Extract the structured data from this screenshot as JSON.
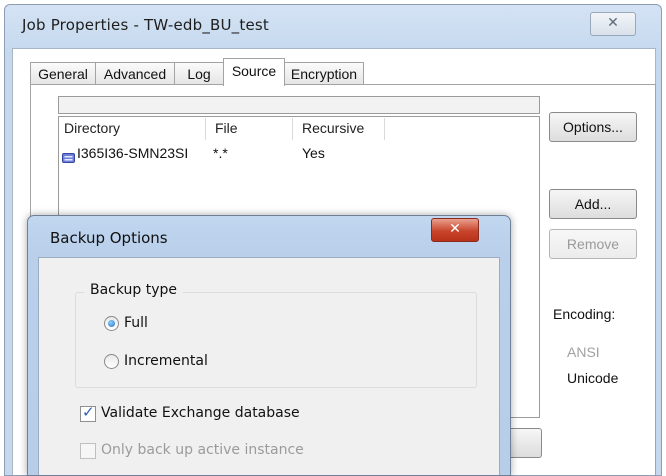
{
  "window": {
    "title": "Job Properties - TW-edb_BU_test",
    "close_glyph": "✕"
  },
  "tabs": [
    {
      "label": "General",
      "selected": false
    },
    {
      "label": "Advanced",
      "selected": false
    },
    {
      "label": "Log",
      "selected": false
    },
    {
      "label": "Source",
      "selected": true
    },
    {
      "label": "Encryption",
      "selected": false
    }
  ],
  "source_list": {
    "columns": [
      "Directory",
      "File",
      "Recursive"
    ],
    "rows": [
      {
        "directory": "I365I36-SMN23SI",
        "file": "*.*",
        "recursive": "Yes",
        "icon": "server-icon"
      }
    ]
  },
  "buttons": {
    "options": "Options...",
    "add": "Add...",
    "remove": "Remove"
  },
  "encoding": {
    "label": "Encoding:",
    "options": [
      "ANSI",
      "Unicode"
    ]
  },
  "backup_dialog": {
    "title": "Backup Options",
    "close_glyph": "✕",
    "group_label": "Backup type",
    "radios": [
      {
        "label": "Full",
        "checked": true
      },
      {
        "label": "Incremental",
        "checked": false
      }
    ],
    "checkboxes": [
      {
        "label": "Validate Exchange database",
        "checked": true,
        "enabled": true
      },
      {
        "label": "Only back up active instance",
        "checked": false,
        "enabled": false
      }
    ]
  },
  "colors": {
    "dialog_close": "#c8442b",
    "window_frame": "#c5d8ee",
    "dialog_frame": "#b9cfea"
  }
}
